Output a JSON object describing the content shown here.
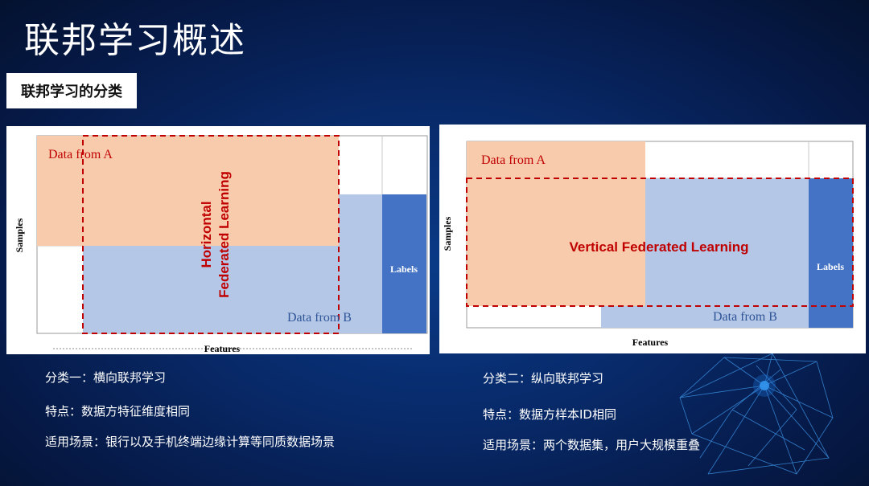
{
  "page": {
    "title": "联邦学习概述",
    "subtitle": "联邦学习的分类"
  },
  "diagrams": {
    "left": {
      "y_axis": "Samples",
      "x_axis": "Features",
      "data_a": "Data from A",
      "data_b": "Data from B",
      "labels": "Labels",
      "federated_line1": "Horizontal",
      "federated_line2": "Federated Learning"
    },
    "right": {
      "y_axis": "Samples",
      "x_axis": "Features",
      "data_a": "Data from A",
      "data_b": "Data from B",
      "labels": "Labels",
      "federated": "Vertical Federated Learning"
    }
  },
  "captions": {
    "left": {
      "category": "分类一：横向联邦学习",
      "feature": "特点：数据方特征维度相同",
      "scenario": "适用场景：银行以及手机终端边缘计算等同质数据场景"
    },
    "right": {
      "category": "分类二：纵向联邦学习",
      "feature": "特点：数据方样本ID相同",
      "scenario": "适用场景：两个数据集，用户大规模重叠"
    }
  },
  "colors": {
    "data_a_fill": "#f8cbad",
    "data_b_fill": "#b4c7e7",
    "labels_fill": "#4472c4",
    "dashed_border": "#c00000",
    "text_red": "#c00000",
    "text_blue": "#2f5597"
  }
}
